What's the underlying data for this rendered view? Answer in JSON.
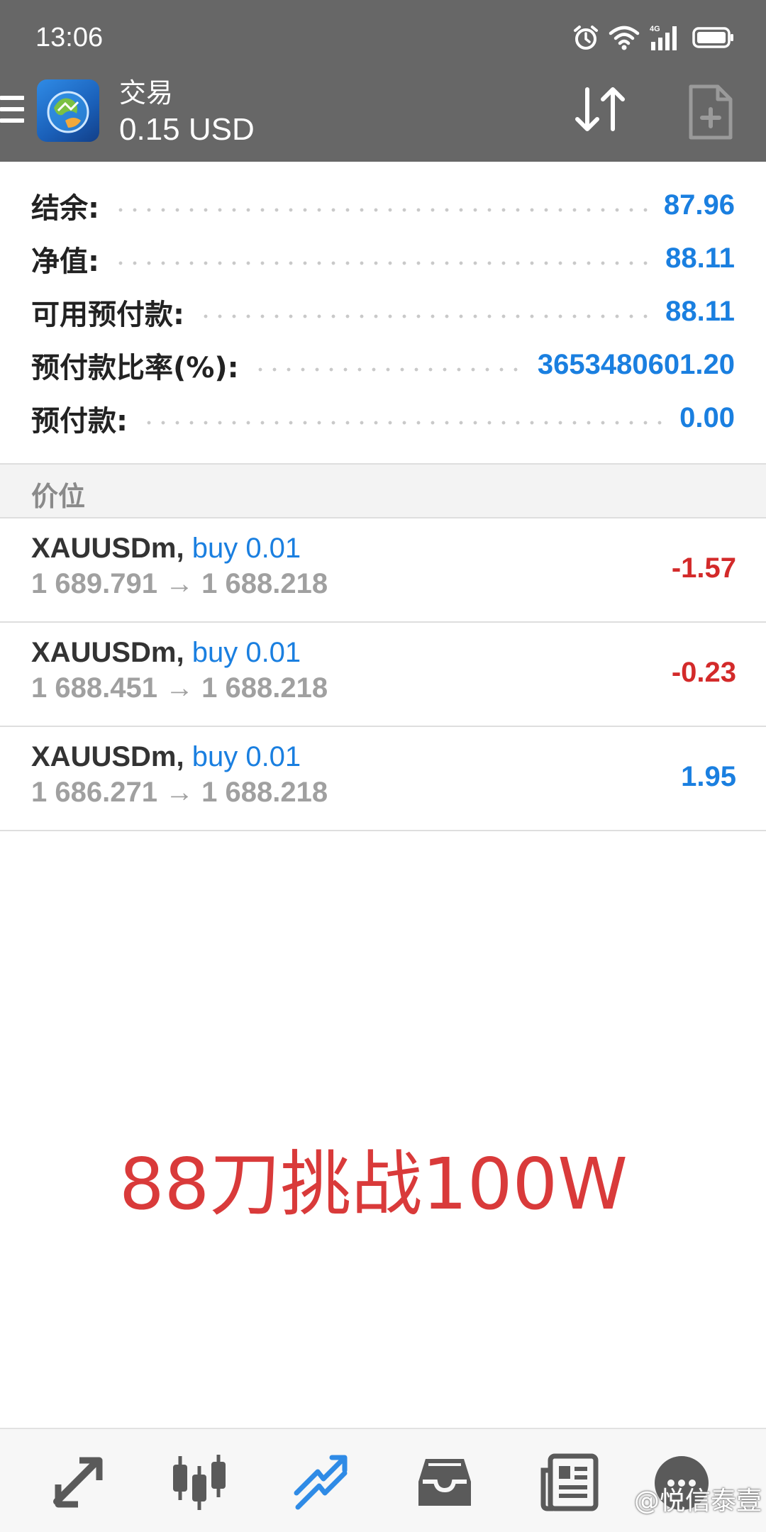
{
  "status_bar": {
    "time": "13:06",
    "icons": [
      "alarm-icon",
      "wifi-icon",
      "signal-4g-icon",
      "battery-icon"
    ],
    "network_label": "4G"
  },
  "app_bar": {
    "title": "交易",
    "subtitle": "0.15 USD",
    "actions": [
      "sort-icon",
      "new-order-icon"
    ]
  },
  "summary": [
    {
      "label": "结余:",
      "value": "87.96"
    },
    {
      "label": "净值:",
      "value": "88.11"
    },
    {
      "label": "可用预付款:",
      "value": "88.11"
    },
    {
      "label": "预付款比率(%):",
      "value": "3653480601.20"
    },
    {
      "label": "预付款:",
      "value": "0.00"
    }
  ],
  "section": {
    "title": "价位"
  },
  "positions": [
    {
      "symbol": "XAUUSDm,",
      "type": "buy 0.01",
      "prices": "1 689.791 → 1 688.218",
      "profit": "-1.57",
      "profit_sign": "negative"
    },
    {
      "symbol": "XAUUSDm,",
      "type": "buy 0.01",
      "prices": "1 688.451 → 1 688.218",
      "profit": "-0.23",
      "profit_sign": "negative"
    },
    {
      "symbol": "XAUUSDm,",
      "type": "buy 0.01",
      "prices": "1 686.271 → 1 688.218",
      "profit": "1.95",
      "profit_sign": "positive"
    }
  ],
  "caption": "88刀挑战100W",
  "bottom_nav": {
    "items": [
      "quotes-icon",
      "chart-icon",
      "trade-icon",
      "history-icon",
      "news-icon",
      "chat-icon"
    ],
    "active": "trade-icon"
  },
  "watermark": "@悦信泰壹",
  "colors": {
    "header_bg": "#676767",
    "accent_blue": "#1a7fe0",
    "loss_red": "#d32a2a",
    "caption_red": "#d93a3a",
    "label_dark": "#222222",
    "muted_gray": "#a0a0a0"
  }
}
